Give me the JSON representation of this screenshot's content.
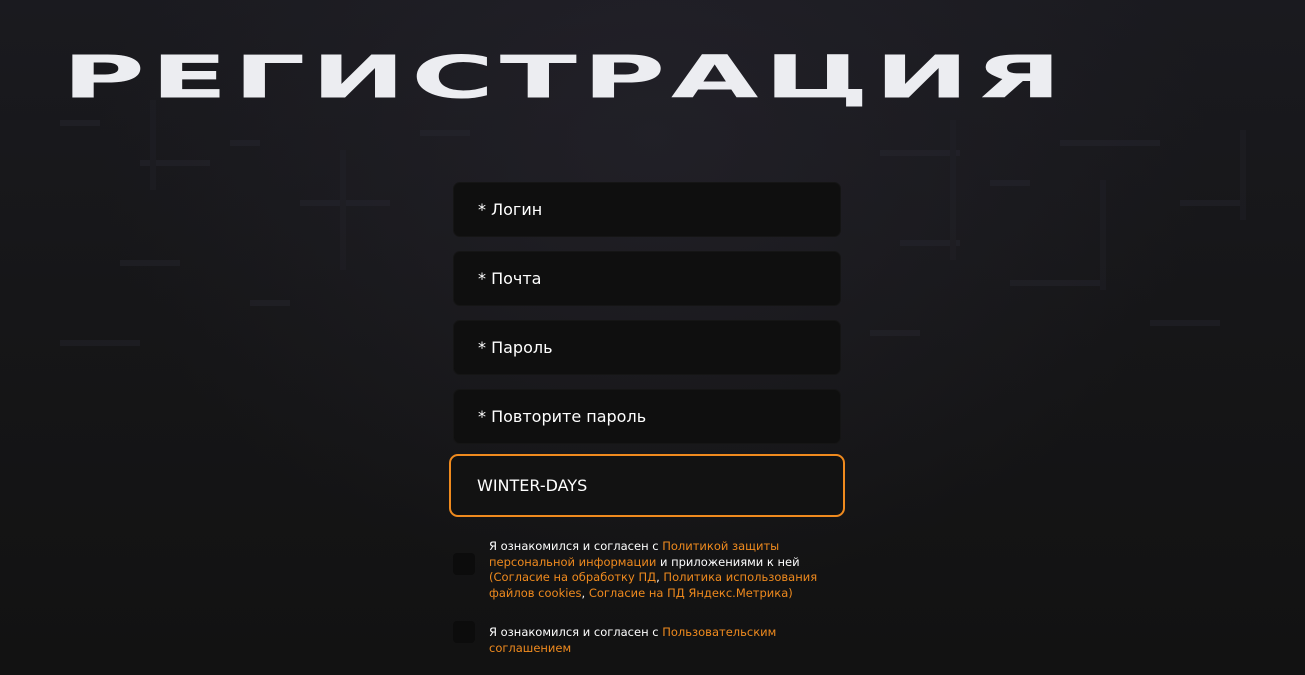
{
  "page": {
    "title": "РЕГИСТРАЦИЯ"
  },
  "form": {
    "login_placeholder": "* Логин",
    "email_placeholder": "* Почта",
    "password_placeholder": "* Пароль",
    "repeat_password_placeholder": "* Повторите пароль",
    "promo_value": "WINTER-DAYS"
  },
  "consent_privacy": {
    "text_before": "Я ознакомился и согласен с ",
    "link_policy": "Политикой защиты персональной информации",
    "text_middle": " и приложениями к ней ",
    "paren_open": "(",
    "link_pd_consent": "Согласие на обработку ПД",
    "sep1": ", ",
    "link_cookies": "Политика использования файлов cookies",
    "sep2": ", ",
    "link_metrika": "Согласие на ПД Яндекс.Метрика",
    "paren_close": ")"
  },
  "consent_terms": {
    "text_before": "Я ознакомился и согласен с ",
    "link_terms": "Пользовательским соглашением"
  },
  "colors": {
    "accent": "#ef8a1e",
    "title": "#ecedf1",
    "background": "#131313",
    "field": "#0f0f0f"
  }
}
